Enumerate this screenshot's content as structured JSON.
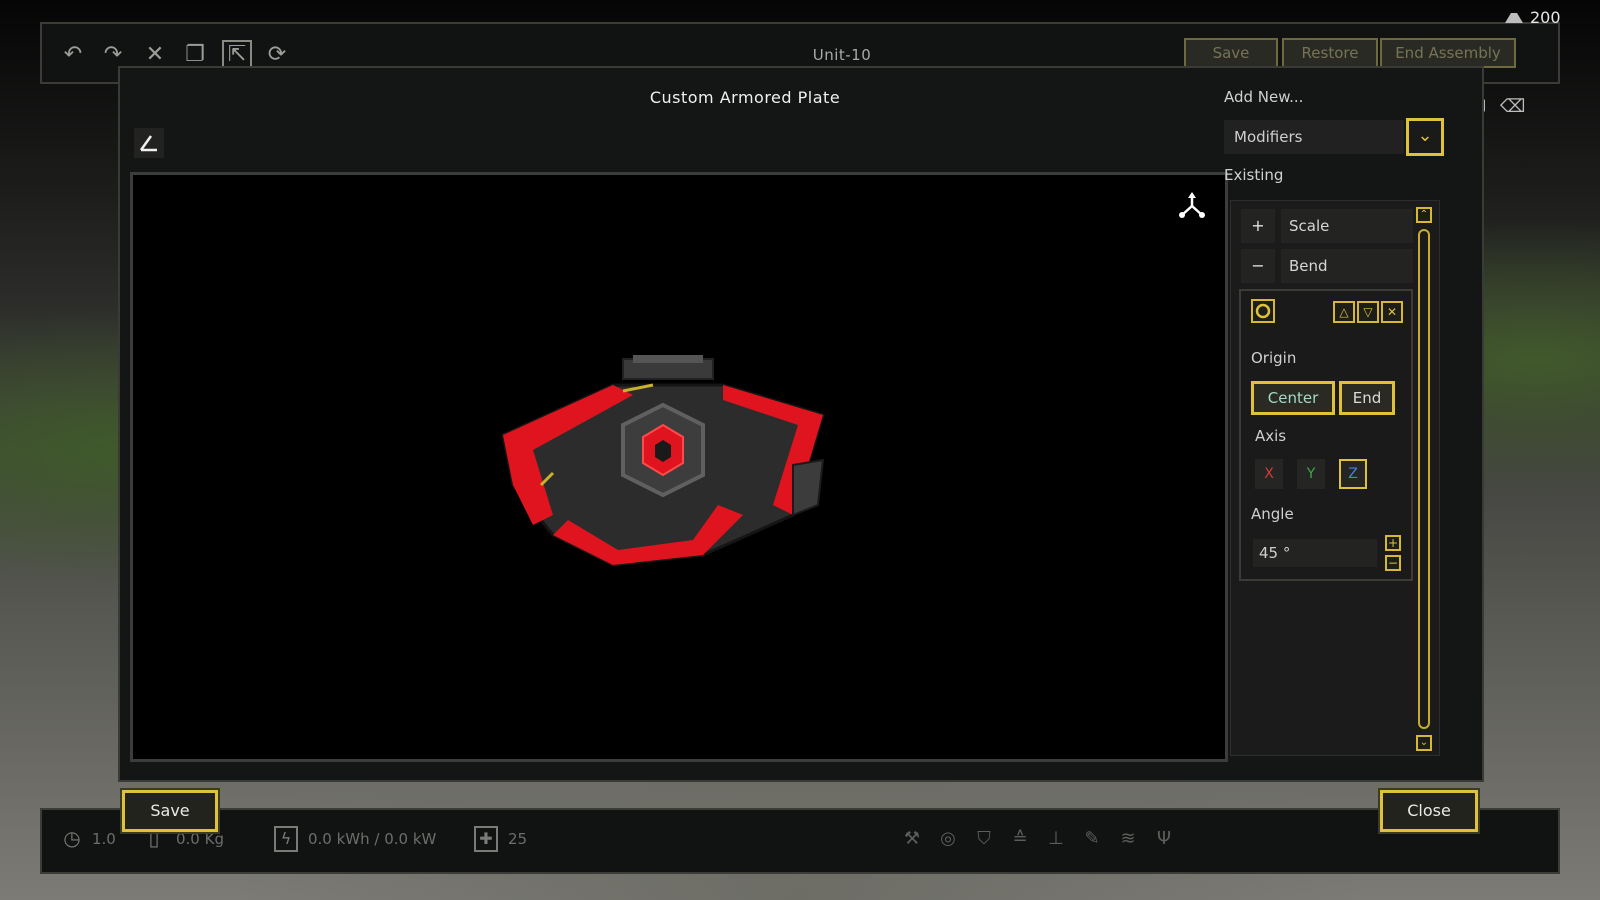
{
  "credits": "200",
  "toolbar": {
    "title": "Unit-10",
    "save_label": "Save",
    "restore_label": "Restore",
    "end_assembly_label": "End Assembly",
    "icons": [
      "undo-icon",
      "redo-icon",
      "delete-icon",
      "copy-icon",
      "select-icon",
      "pivot-icon"
    ]
  },
  "dialog": {
    "title": "Custom Armored Plate",
    "add_new_label": "Add New...",
    "modifier_select_value": "Modifiers",
    "existing_label": "Existing",
    "modifiers": [
      {
        "symbol": "+",
        "label": "Scale"
      },
      {
        "symbol": "−",
        "label": "Bend"
      }
    ],
    "bend": {
      "origin_label": "Origin",
      "origin_options": [
        "Center",
        "End"
      ],
      "origin_selected": "Center",
      "axis_label": "Axis",
      "axis_options": [
        "X",
        "Y",
        "Z"
      ],
      "axis_selected": "Z",
      "angle_label": "Angle",
      "angle_value": "45 °"
    }
  },
  "footer": {
    "save_label": "Save",
    "close_label": "Close",
    "time_value": "1.0",
    "mass_value": "0.0 Kg",
    "power_value": "0.0 kWh / 0.0 kW",
    "health_value": "25"
  },
  "colors": {
    "accent": "#e0c23a",
    "axis_x": "#d23b3b",
    "axis_y": "#3fa64a",
    "axis_z": "#4a7fe0",
    "plate_red": "#e0141e"
  }
}
